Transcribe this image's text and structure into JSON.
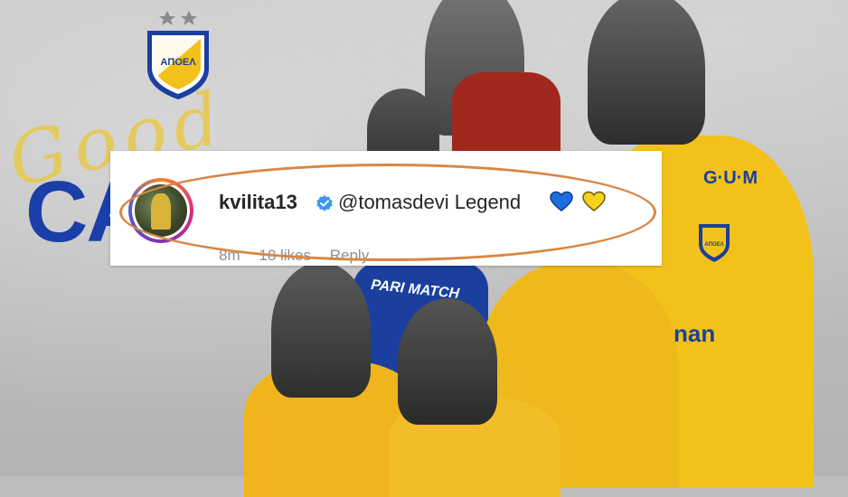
{
  "background": {
    "script_text": "Good luck",
    "big_text": "CA",
    "sponsor_gum": "G·U·M",
    "sponsor_pari": "PARI MATCH",
    "sponsor_nan": "nan",
    "crest_text": "ΑΠΟΕΛ",
    "mini_crest_text": "ΑΠΟΕΛ"
  },
  "comment": {
    "username": "kvilita13",
    "mention": "@tomasdevi",
    "text": "Legend",
    "hearts": [
      "blue-heart-icon",
      "yellow-heart-icon"
    ],
    "time": "8m",
    "likes": "18 likes",
    "reply": "Reply"
  },
  "colors": {
    "highlight": "#d88744",
    "blue": "#1a3f9e",
    "yellow": "#f2c21a",
    "verified": "#3897f0"
  }
}
